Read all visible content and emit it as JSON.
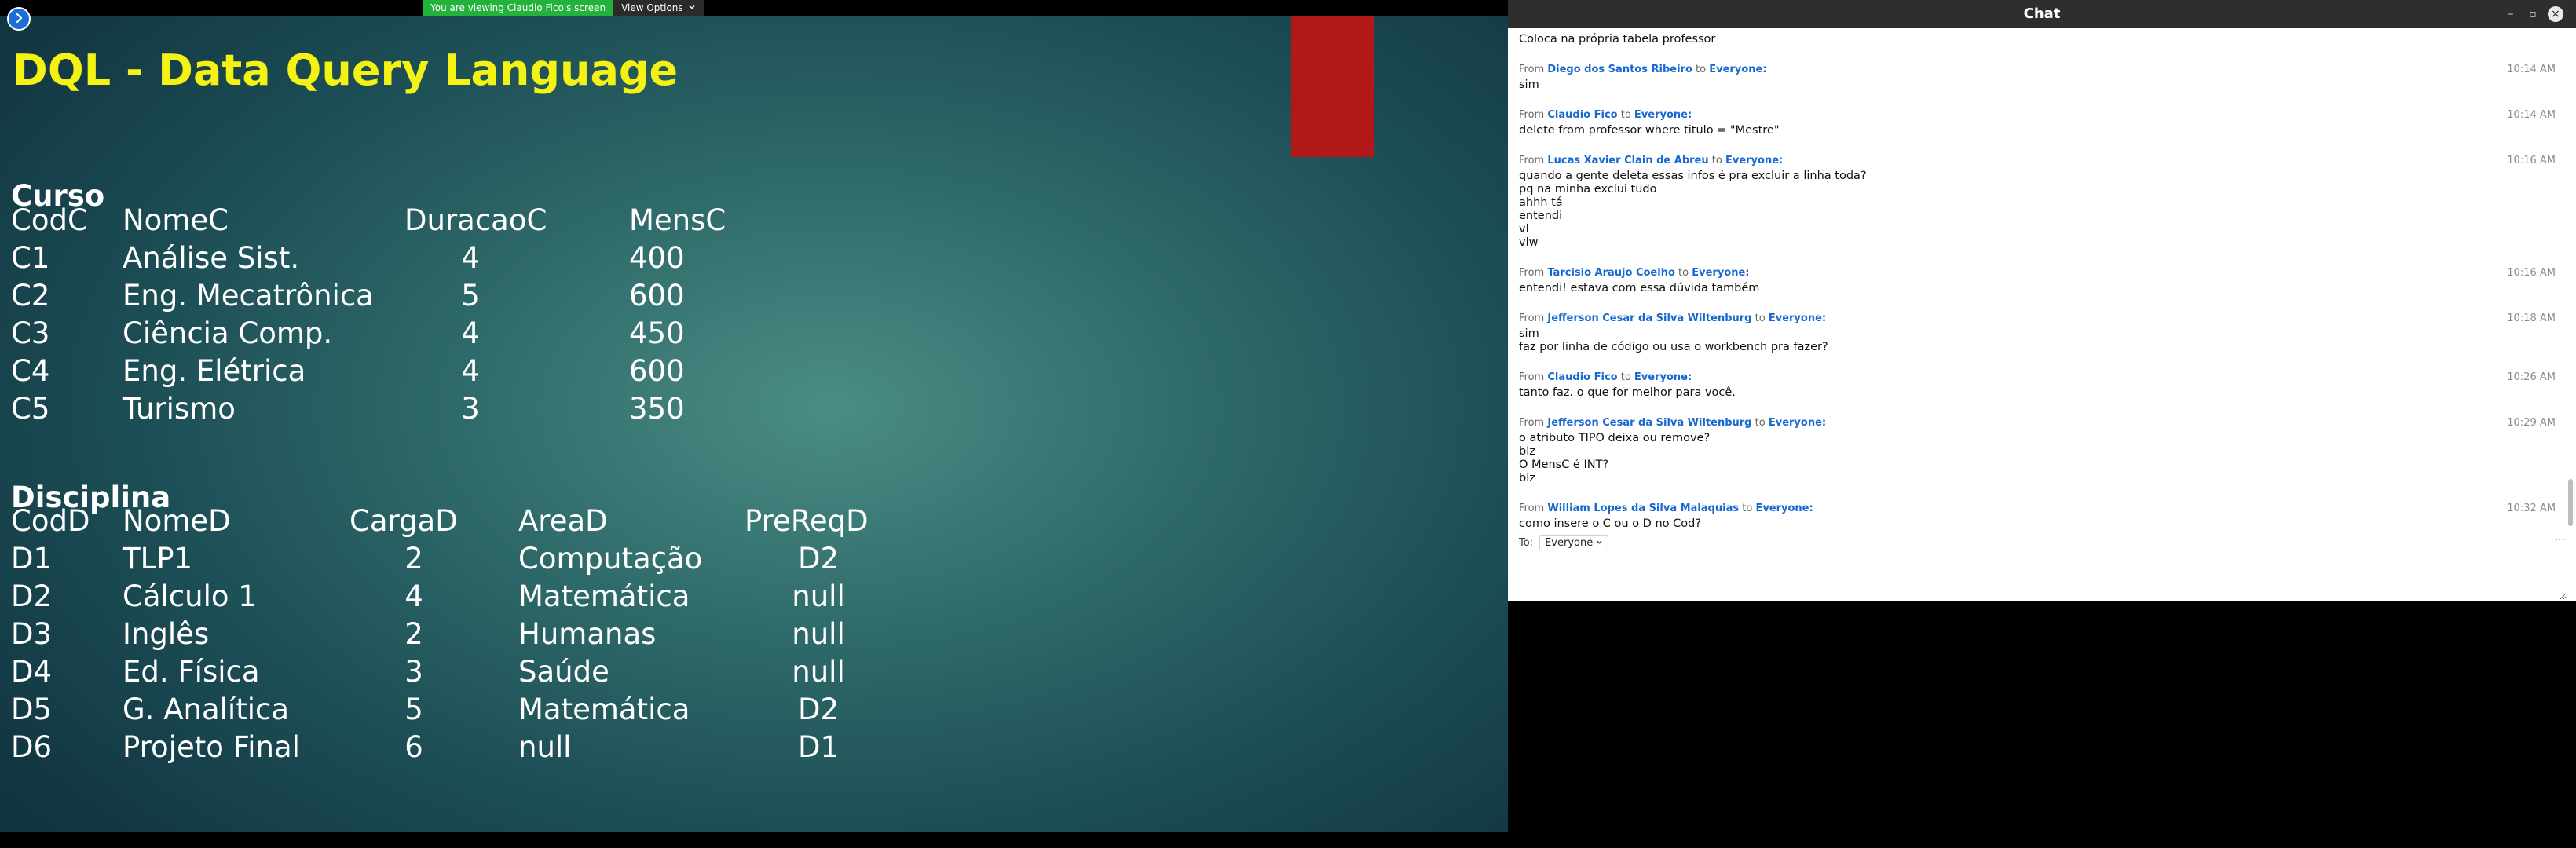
{
  "share": {
    "banner_text": "You are viewing Claudio Fico's screen",
    "view_options_label": "View Options",
    "slide": {
      "title": "DQL - Data Query Language",
      "curso": {
        "name": "Curso",
        "headers": [
          "CodC",
          "NomeC",
          "DuracaoC",
          "MensC"
        ],
        "rows": [
          [
            "C1",
            "Análise Sist.",
            "4",
            "400"
          ],
          [
            "C2",
            "Eng. Mecatrônica",
            "5",
            "600"
          ],
          [
            "C3",
            "Ciência Comp.",
            "4",
            "450"
          ],
          [
            "C4",
            "Eng. Elétrica",
            "4",
            "600"
          ],
          [
            "C5",
            "Turismo",
            "3",
            "350"
          ]
        ]
      },
      "disciplina": {
        "name": "Disciplina",
        "headers": [
          "CodD",
          "NomeD",
          "CargaD",
          "AreaD",
          "PreReqD"
        ],
        "rows": [
          [
            "D1",
            "TLP1",
            "2",
            "Computação",
            "D2"
          ],
          [
            "D2",
            "Cálculo 1",
            "4",
            "Matemática",
            "null"
          ],
          [
            "D3",
            "Inglês",
            "2",
            "Humanas",
            "null"
          ],
          [
            "D4",
            "Ed. Física",
            "3",
            "Saúde",
            "null"
          ],
          [
            "D5",
            "G. Analítica",
            "5",
            "Matemática",
            "D2"
          ],
          [
            "D6",
            "Projeto Final",
            "6",
            "null",
            "D1"
          ]
        ]
      }
    }
  },
  "chat": {
    "title": "Chat",
    "messages": [
      {
        "sender": "",
        "to": "",
        "time": "",
        "lines": [
          "Coloca na própria tabela professor"
        ]
      },
      {
        "sender": "Diego dos Santos Ribeiro",
        "to": "Everyone:",
        "time": "10:14 AM",
        "lines": [
          "sim"
        ]
      },
      {
        "sender": "Claudio Fico",
        "to": "Everyone:",
        "time": "10:14 AM",
        "lines": [
          "delete from professor where titulo = \"Mestre\""
        ]
      },
      {
        "sender": "Lucas Xavier Clain de Abreu",
        "to": "Everyone:",
        "time": "10:16 AM",
        "lines": [
          "quando a gente deleta essas infos é pra excluir a linha toda?",
          "pq na minha exclui tudo",
          "ahhh tá",
          "entendi",
          "vl",
          "vlw"
        ]
      },
      {
        "sender": "Tarcisio Araujo Coelho",
        "to": "Everyone:",
        "time": "10:16 AM",
        "lines": [
          "entendi! estava com essa dúvida também"
        ]
      },
      {
        "sender": "Jefferson Cesar da Silva Wiltenburg",
        "to": "Everyone:",
        "time": "10:18 AM",
        "lines": [
          "sim",
          "faz por linha de código ou usa o workbench pra fazer?"
        ]
      },
      {
        "sender": "Claudio Fico",
        "to": "Everyone:",
        "time": "10:26 AM",
        "lines": [
          "tanto faz. o que for melhor para você."
        ]
      },
      {
        "sender": "Jefferson Cesar da Silva Wiltenburg",
        "to": "Everyone:",
        "time": "10:29 AM",
        "lines": [
          "o atributo TIPO deixa ou remove?",
          "blz",
          "O MensC é INT?",
          "blz"
        ]
      },
      {
        "sender": "William Lopes da Silva Malaquias",
        "to": "Everyone:",
        "time": "10:32 AM",
        "lines": [
          "como insere o C ou o D no Cod?"
        ]
      }
    ],
    "from_word": "From",
    "to_word": "to",
    "composer": {
      "to_label": "To:",
      "recipient": "Everyone",
      "more_label": "···"
    }
  }
}
